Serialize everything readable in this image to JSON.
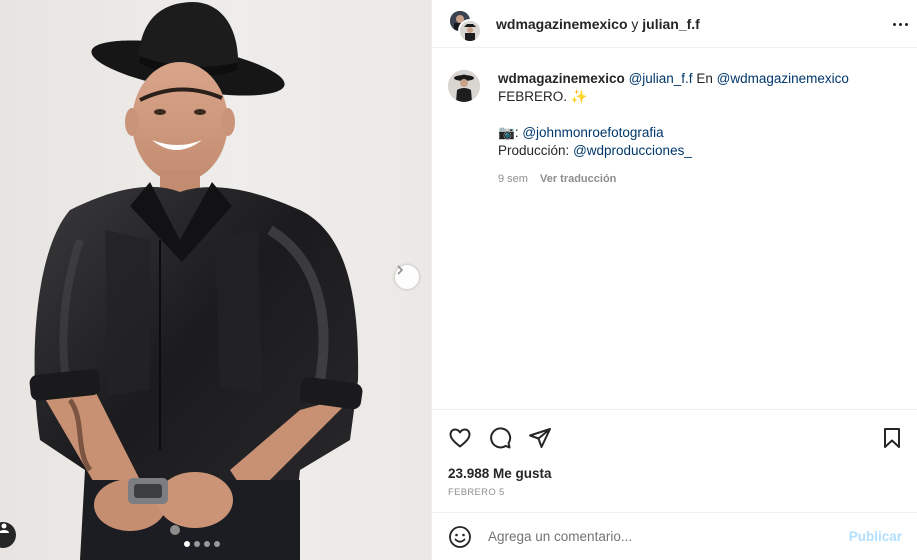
{
  "post": {
    "header": {
      "account": "wdmagazinemexico",
      "conjunction": "y",
      "collaborator": "julian_f.f"
    },
    "caption": {
      "username": "wdmagazinemexico",
      "mention_collab": "@julian_f.f",
      "text_en": "En",
      "mention_mag": "@wdmagazinemexico",
      "line2": "FEBRERO. ✨",
      "camera_emoji": "📷",
      "colon": ":",
      "photographer": "@johnmonroefotografia",
      "production_label": "Producción:",
      "producer": "@wdproducciones_",
      "time_ago": "9 sem",
      "translate": "Ver traducción"
    },
    "likes": "23.988 Me gusta",
    "date": "FEBRERO 5",
    "comment": {
      "placeholder": "Agrega un comentario...",
      "publish": "Publicar"
    },
    "carousel": {
      "total_slides": 4,
      "current_slide": 1
    }
  },
  "icons": {
    "like": "heart-icon",
    "comment": "comment-icon",
    "share": "share-icon",
    "save": "bookmark-icon",
    "more": "more-icon",
    "emoji": "emoji-icon",
    "next": "chevron-right-icon",
    "tag": "person-tag-icon"
  },
  "colors": {
    "text": "#262626",
    "secondary": "#8e8e8e",
    "link": "#00376b",
    "publish_disabled": "#b2dffc",
    "border": "#efefef"
  }
}
